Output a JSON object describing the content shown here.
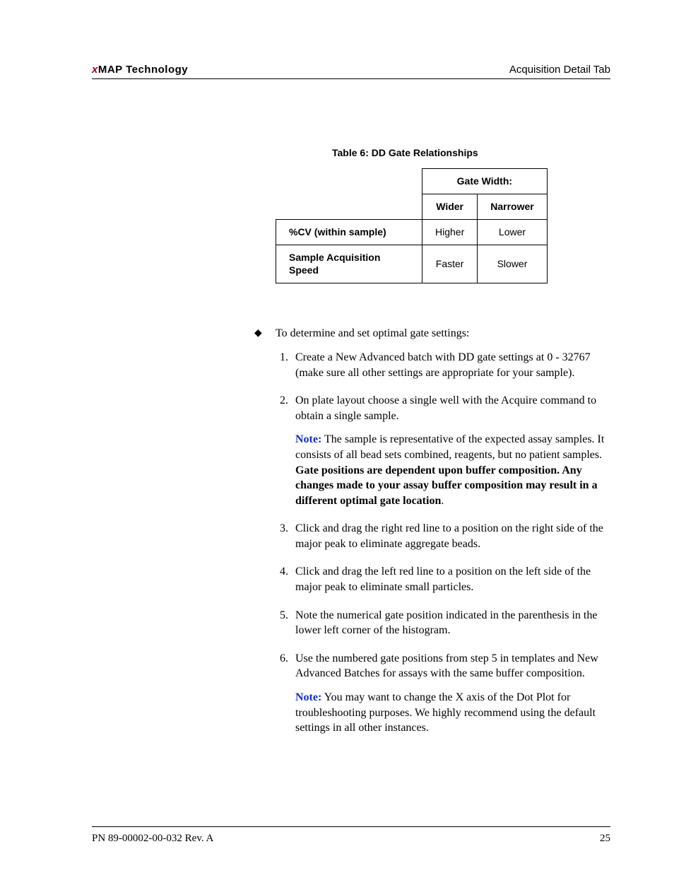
{
  "header": {
    "brand_x": "x",
    "brand_rest": "MAP  Technology",
    "right": "Acquisition Detail Tab"
  },
  "table": {
    "caption": "Table 6: DD Gate Relationships",
    "spanhdr": "Gate Width:",
    "cols": [
      "Wider",
      "Narrower"
    ],
    "rows": [
      {
        "label": "%CV (within sample)",
        "cells": [
          "Higher",
          "Lower"
        ]
      },
      {
        "label": "Sample Acquisition Speed",
        "cells": [
          "Faster",
          "Slower"
        ]
      }
    ]
  },
  "intro": "To determine and set optimal gate settings:",
  "steps": [
    {
      "text": "Create a New Advanced batch with DD gate settings at 0 - 32767 (make sure all other settings are appropriate for your sample)."
    },
    {
      "text": "On plate layout choose a single well with the Acquire command to obtain a single sample.",
      "note_label": "Note:",
      "note_pre": " The sample is representative of the expected assay samples. It consists of all bead sets combined, reagents, but no patient samples. ",
      "note_bold": "Gate positions are dependent upon buffer composition. Any changes made to your assay buffer composition may result in a different optimal gate location",
      "note_post": "."
    },
    {
      "text": "Click and drag the right red line to a position on the right side of the major peak to eliminate aggregate beads."
    },
    {
      "text": "Click and drag the left red line to a position on the left side of the major peak to eliminate small particles."
    },
    {
      "text": "Note the numerical gate position indicated in the parenthesis in the lower left corner of the histogram."
    },
    {
      "text": "Use the numbered gate positions from step 5 in templates and New Advanced Batches for assays with the same buffer composition.",
      "note_label": "Note:",
      "note_pre": " You may want to change the X axis of the Dot Plot for troubleshooting purposes. We highly recommend using the default settings in all other instances."
    }
  ],
  "footer": {
    "left": "PN 89-00002-00-032 Rev. A",
    "right": "25"
  }
}
